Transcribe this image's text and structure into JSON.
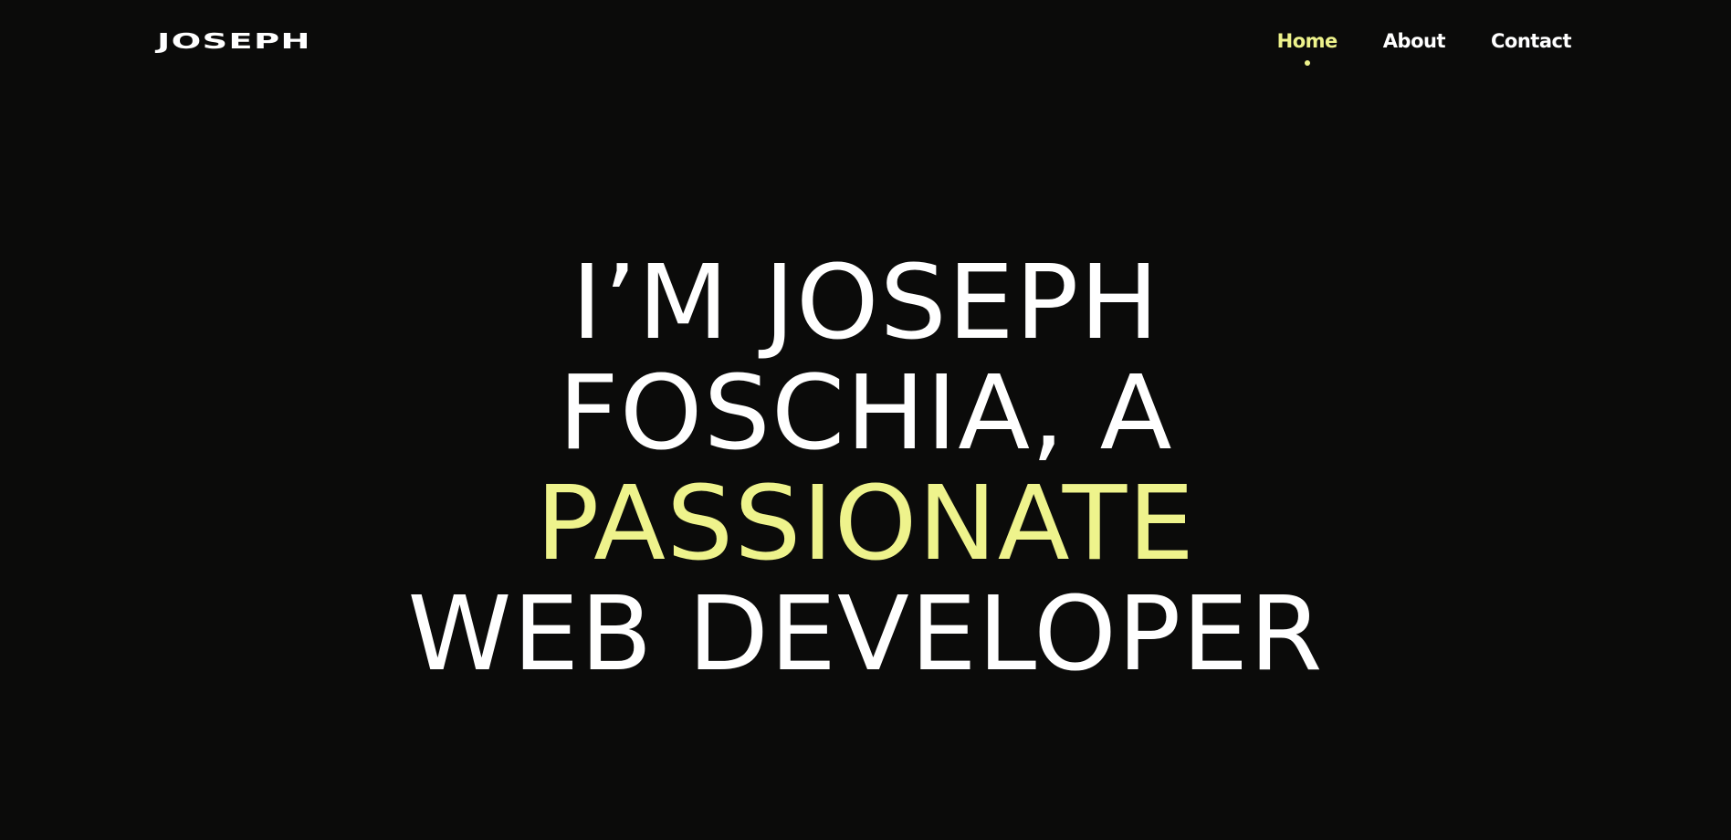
{
  "brand": {
    "logo_text": "JOSEPH"
  },
  "nav": {
    "items": [
      {
        "label": "Home",
        "active": true
      },
      {
        "label": "About",
        "active": false
      },
      {
        "label": "Contact",
        "active": false
      }
    ]
  },
  "hero": {
    "line1": "I’M JOSEPH",
    "line2": "FOSCHIA, A",
    "line3": "PASSIONATE",
    "line4": "WEB DEVELOPER"
  },
  "colors": {
    "background": "#0b0b0a",
    "text": "#ffffff",
    "accent": "#eef38c"
  }
}
